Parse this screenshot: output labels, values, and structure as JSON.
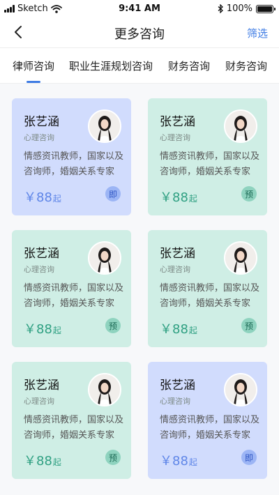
{
  "status_bar": {
    "carrier": "Sketch",
    "time": "9:41 AM",
    "battery": "100%",
    "icons": [
      "signal-icon",
      "wifi-icon",
      "bluetooth-icon",
      "battery-icon"
    ]
  },
  "nav": {
    "title": "更多咨询",
    "filter_label": "筛选",
    "back_icon": "chevron-left-icon"
  },
  "tabs": [
    {
      "label": "律师咨询",
      "active": true
    },
    {
      "label": "职业生涯规划咨询",
      "active": false
    },
    {
      "label": "财务咨询",
      "active": false
    },
    {
      "label": "财务咨询",
      "active": false
    }
  ],
  "colors": {
    "accent": "#3d7be4",
    "card_green": "#cfeee5",
    "card_blue": "#d1dcfd",
    "price_green": "#2fa082",
    "price_blue": "#5f86e8"
  },
  "cards": [
    {
      "name": "张艺涵",
      "role": "心理咨询",
      "desc": "情感资讯教师，国家以及咨询师，婚姻关系专家",
      "price": "￥88",
      "price_unit": "起",
      "badge": "即",
      "theme": "blue"
    },
    {
      "name": "张艺涵",
      "role": "心理咨询",
      "desc": "情感资讯教师，国家以及咨询师，婚姻关系专家",
      "price": "￥88",
      "price_unit": "起",
      "badge": "预",
      "theme": "green"
    },
    {
      "name": "张艺涵",
      "role": "心理咨询",
      "desc": "情感资讯教师，国家以及咨询师，婚姻关系专家",
      "price": "￥88",
      "price_unit": "起",
      "badge": "预",
      "theme": "green"
    },
    {
      "name": "张艺涵",
      "role": "心理咨询",
      "desc": "情感资讯教师，国家以及咨询师，婚姻关系专家",
      "price": "￥88",
      "price_unit": "起",
      "badge": "预",
      "theme": "green"
    },
    {
      "name": "张艺涵",
      "role": "心理咨询",
      "desc": "情感资讯教师，国家以及咨询师，婚姻关系专家",
      "price": "￥88",
      "price_unit": "起",
      "badge": "预",
      "theme": "green"
    },
    {
      "name": "张艺涵",
      "role": "心理咨询",
      "desc": "情感资讯教师，国家以及咨询师，婚姻关系专家",
      "price": "￥88",
      "price_unit": "起",
      "badge": "即",
      "theme": "blue"
    }
  ]
}
